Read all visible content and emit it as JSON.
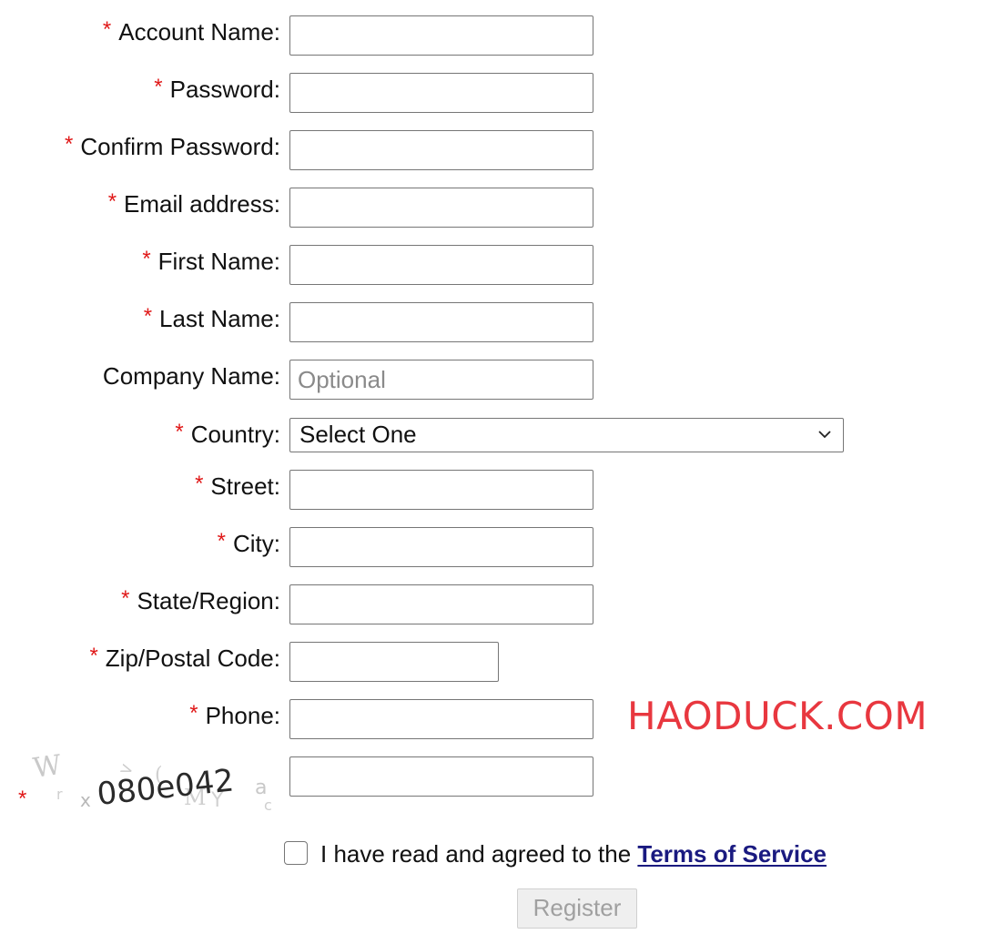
{
  "form": {
    "required_marker": "*",
    "fields": [
      {
        "label": "Account Name:",
        "required": true,
        "value": "",
        "placeholder": ""
      },
      {
        "label": "Password:",
        "required": true,
        "value": "",
        "placeholder": ""
      },
      {
        "label": "Confirm Password:",
        "required": true,
        "value": "",
        "placeholder": ""
      },
      {
        "label": "Email address:",
        "required": true,
        "value": "",
        "placeholder": ""
      },
      {
        "label": "First Name:",
        "required": true,
        "value": "",
        "placeholder": ""
      },
      {
        "label": "Last Name:",
        "required": true,
        "value": "",
        "placeholder": ""
      },
      {
        "label": "Company Name:",
        "required": false,
        "value": "",
        "placeholder": "Optional"
      },
      {
        "label": "Country:",
        "required": true,
        "selected": "Select One"
      },
      {
        "label": "Street:",
        "required": true,
        "value": "",
        "placeholder": ""
      },
      {
        "label": "City:",
        "required": true,
        "value": "",
        "placeholder": ""
      },
      {
        "label": "State/Region:",
        "required": true,
        "value": "",
        "placeholder": ""
      },
      {
        "label": "Zip/Postal Code:",
        "required": true,
        "value": "",
        "placeholder": ""
      },
      {
        "label": "Phone:",
        "required": true,
        "value": "",
        "placeholder": ""
      }
    ],
    "captcha": {
      "required": true,
      "code": "080e042",
      "value": ""
    },
    "agreement": {
      "checked": false,
      "text": "I have read and agreed to the",
      "link_text": "Terms of Service"
    },
    "submit_label": "Register"
  },
  "watermark": "HAODUCK.COM",
  "colors": {
    "required": "#e01818",
    "link": "#1a1a80",
    "watermark": "#e8373f",
    "disabled_text": "#a0a0a0"
  },
  "icons": {
    "country_dropdown": "chevron-down-icon",
    "captcha": "captcha-image"
  }
}
